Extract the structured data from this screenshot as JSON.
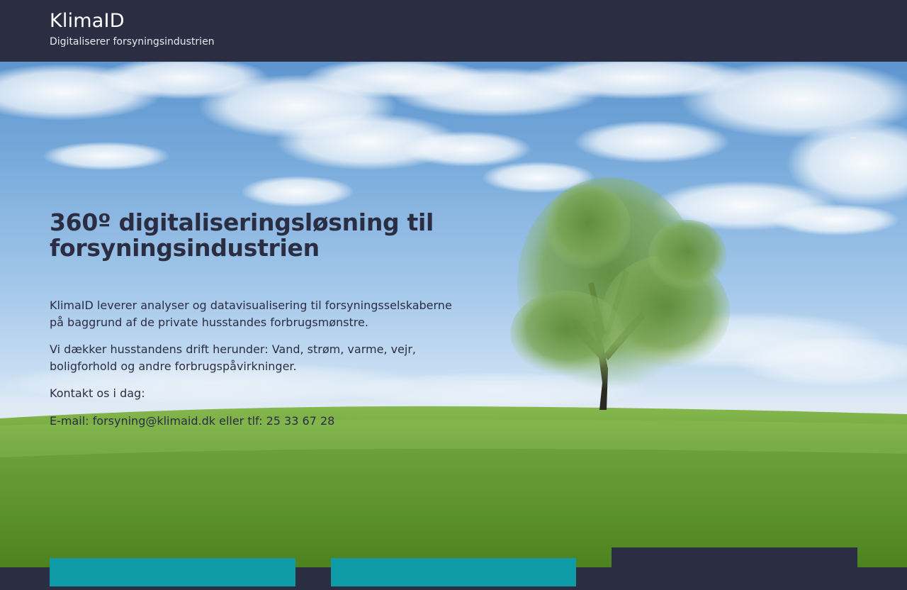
{
  "header": {
    "site_title": "KlimaID",
    "tagline": "Digitaliserer forsyningsindustrien"
  },
  "hero": {
    "heading": "360º digitaliseringsløsning til forsyningsindustrien",
    "paragraphs": [
      "KlimaID leverer analyser og datavisualisering til forsyningsselskaberne på baggrund af de private husstandes forbrugsmønstre.",
      "Vi dækker husstandens drift herunder: Vand, strøm, varme, vejr, boligforhold og andre forbrugspåvirkninger.",
      "Kontakt os i dag:"
    ],
    "contact": {
      "email_label": "E-mail:",
      "email": "forsyning@klimaid.dk",
      "phone_prefix": "eller tlf:",
      "phone": "25 33 67 28"
    },
    "background_image": "sky-meadow-tree"
  },
  "colors": {
    "header_bg": "#2b2d43",
    "text_dark": "#2b2d42",
    "accent_teal": "#0e9aa7",
    "grass": "#5f9a2e"
  }
}
